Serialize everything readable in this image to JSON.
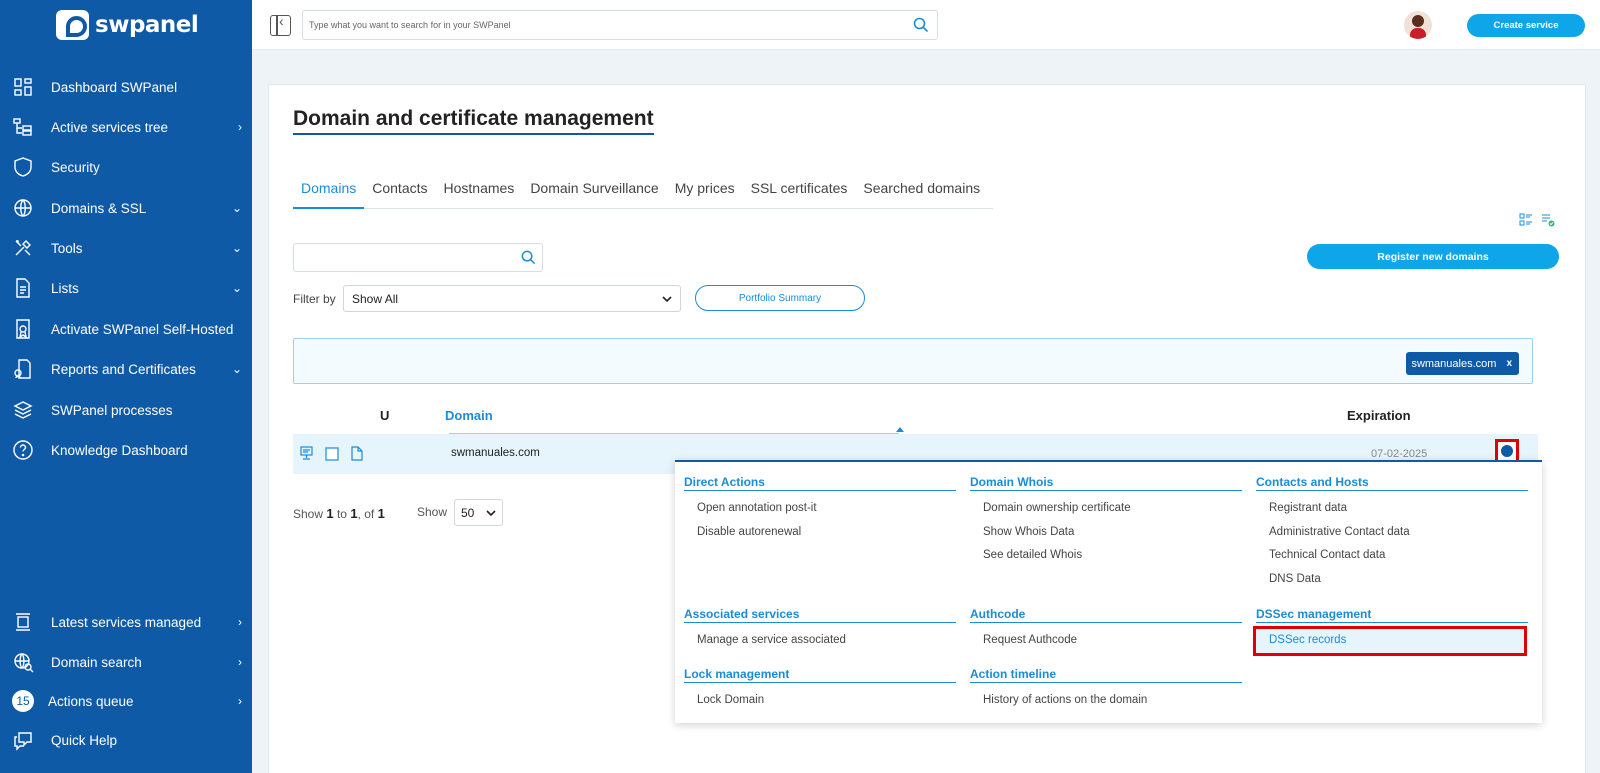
{
  "brand": {
    "name": "swpanel"
  },
  "sidebar": {
    "items": [
      {
        "label": "Dashboard SWPanel",
        "icon": "dashboard-icon",
        "chevron": ""
      },
      {
        "label": "Active services tree",
        "icon": "tree-icon",
        "chevron": "›"
      },
      {
        "label": "Security",
        "icon": "shield-icon",
        "chevron": ""
      },
      {
        "label": "Domains & SSL",
        "icon": "www-icon",
        "chevron": "⌄"
      },
      {
        "label": "Tools",
        "icon": "tools-icon",
        "chevron": "⌄"
      },
      {
        "label": "Lists",
        "icon": "document-icon",
        "chevron": "⌄"
      },
      {
        "label": "Activate SWPanel Self-Hosted",
        "icon": "certificate-icon",
        "chevron": ""
      },
      {
        "label": "Reports and Certificates",
        "icon": "report-icon",
        "chevron": "⌄"
      },
      {
        "label": "SWPanel processes",
        "icon": "layers-icon",
        "chevron": ""
      },
      {
        "label": "Knowledge Dashboard",
        "icon": "help-circle-icon",
        "chevron": ""
      }
    ],
    "bottom_items": [
      {
        "label": "Latest services managed",
        "icon": "services-icon",
        "chevron": "›"
      },
      {
        "label": "Domain search",
        "icon": "globe-search-icon",
        "chevron": "›"
      },
      {
        "label": "Actions queue",
        "icon": "queue-badge",
        "badge": "15",
        "chevron": "›"
      },
      {
        "label": "Quick Help",
        "icon": "chat-icon",
        "chevron": ""
      }
    ]
  },
  "topbar": {
    "search_placeholder": "Type what you want to search for in your SWPanel",
    "create_label": "Create service"
  },
  "page": {
    "title": "Domain and certificate management",
    "tabs": [
      {
        "label": "Domains",
        "active": true
      },
      {
        "label": "Contacts",
        "active": false
      },
      {
        "label": "Hostnames",
        "active": false
      },
      {
        "label": "Domain Surveillance",
        "active": false
      },
      {
        "label": "My prices",
        "active": false
      },
      {
        "label": "SSL certificates",
        "active": false
      },
      {
        "label": "Searched domains",
        "active": false
      }
    ],
    "register_label": "Register new domains",
    "filter_label": "Filter by",
    "filter_value": "Show All",
    "portfolio_label": "Portfolio Summary",
    "active_filter_chip": "swmanuales.com",
    "chip_close": "x"
  },
  "table": {
    "col_u": "U",
    "col_domain": "Domain",
    "col_expiration": "Expiration",
    "rows": [
      {
        "domain": "swmanuales.com",
        "expiration": "07-02-2025"
      }
    ]
  },
  "pager": {
    "show_prefix": "Show",
    "from": "1",
    "to_word": "to",
    "to": "1",
    "of_word": ", of",
    "total": "1",
    "show_label": "Show",
    "per_page": "50"
  },
  "dropdown": {
    "sections": [
      {
        "title": "Direct Actions",
        "items": [
          "Open annotation post-it",
          "Disable autorenewal"
        ]
      },
      {
        "title": "Domain Whois",
        "items": [
          "Domain ownership certificate",
          "Show Whois Data",
          "See detailed Whois"
        ]
      },
      {
        "title": "Contacts and Hosts",
        "items": [
          "Registrant data",
          "Administrative Contact data",
          "Technical Contact data",
          "DNS Data"
        ]
      },
      {
        "title": "Associated services",
        "items": [
          "Manage a service associated"
        ]
      },
      {
        "title": "Authcode",
        "items": [
          "Request Authcode"
        ]
      },
      {
        "title": "DSSec management",
        "items": [
          "DSSec records"
        ]
      },
      {
        "title": "Lock management",
        "items": [
          "Lock Domain"
        ]
      },
      {
        "title": "Action timeline",
        "items": [
          "History of actions on the domain"
        ]
      }
    ]
  },
  "colors": {
    "sidebar": "#0f5aa6",
    "accent": "#0ea5e9",
    "link": "#1a8cd8",
    "highlight_border": "#e00000"
  }
}
